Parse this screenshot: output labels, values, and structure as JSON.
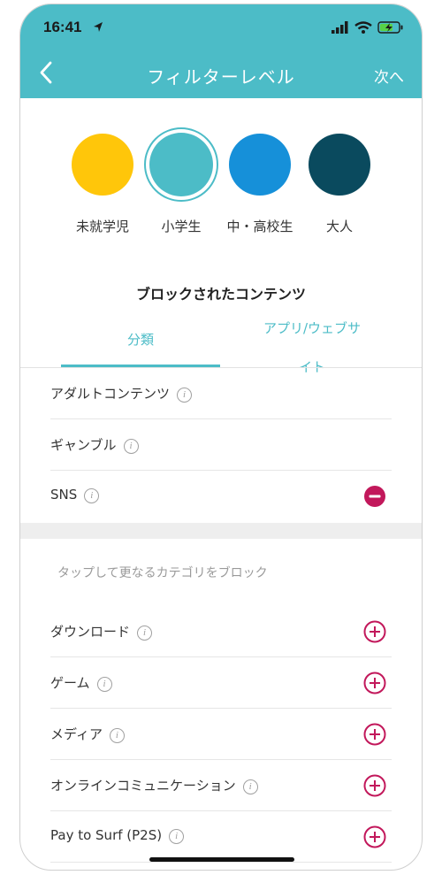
{
  "status": {
    "time": "16:41"
  },
  "nav": {
    "title": "フィルターレベル",
    "next_label": "次へ"
  },
  "levels": [
    {
      "label": "未就学児",
      "color": "#ffc60a",
      "selected": false
    },
    {
      "label": "小学生",
      "color": "#4cbcc7",
      "selected": true
    },
    {
      "label": "中・高校生",
      "color": "#1690d9",
      "selected": false
    },
    {
      "label": "大人",
      "color": "#0a4a5e",
      "selected": false
    }
  ],
  "blocked": {
    "title": "ブロックされたコンテンツ",
    "tabs": [
      {
        "label": "分類",
        "active": true
      },
      {
        "label_line1": "アプリ/ウェブサ",
        "label_line2": "イト",
        "active": false
      }
    ],
    "items": [
      {
        "label": "アダルトコンテンツ",
        "action": "none"
      },
      {
        "label": "ギャンブル",
        "action": "none"
      },
      {
        "label": "SNS",
        "action": "remove"
      }
    ]
  },
  "more": {
    "hint": "タップして更なるカテゴリをブロック",
    "items": [
      {
        "label": "ダウンロード",
        "action": "add"
      },
      {
        "label": "ゲーム",
        "action": "add"
      },
      {
        "label": "メディア",
        "action": "add"
      },
      {
        "label": "オンラインコミュニケーション",
        "action": "add"
      },
      {
        "label": "Pay to Surf (P2S)",
        "action": "add"
      }
    ]
  },
  "colors": {
    "accent": "#4cbcc7",
    "danger": "#c2185b"
  }
}
